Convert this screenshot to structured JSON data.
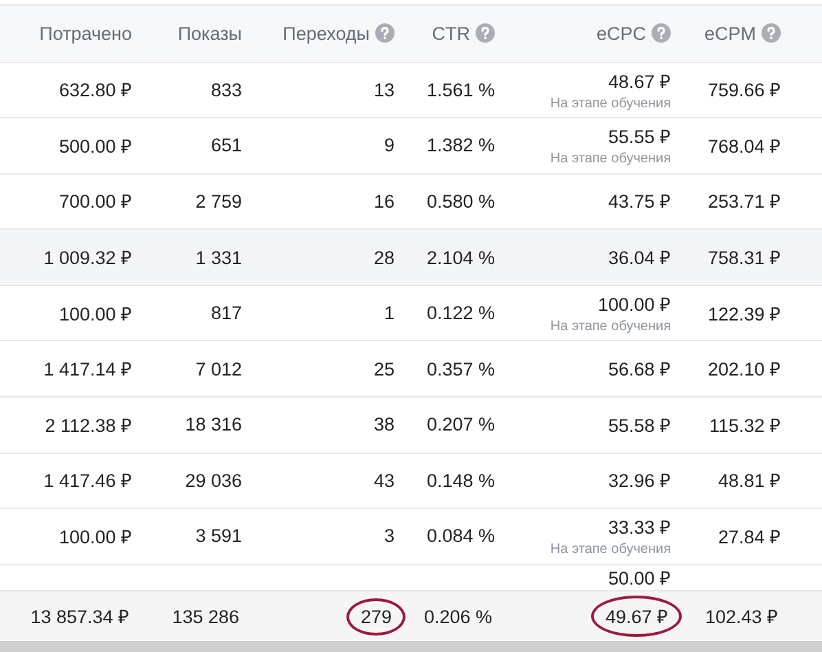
{
  "columns": [
    {
      "label": "Потрачено",
      "help": false
    },
    {
      "label": "Показы",
      "help": false
    },
    {
      "label": "Переходы",
      "help": true
    },
    {
      "label": "CTR",
      "help": true
    },
    {
      "label": "eCPC",
      "help": true
    },
    {
      "label": "eCPM",
      "help": true
    }
  ],
  "rows": [
    {
      "highlighted": false,
      "spent": "632.80 ₽",
      "impressions": "833",
      "clicks": "13",
      "ctr": "1.561 %",
      "ecpc": "48.67 ₽",
      "ecpc_note": "На этапе обучения",
      "ecpm": "759.66 ₽"
    },
    {
      "highlighted": false,
      "spent": "500.00 ₽",
      "impressions": "651",
      "clicks": "9",
      "ctr": "1.382 %",
      "ecpc": "55.55 ₽",
      "ecpc_note": "На этапе обучения",
      "ecpm": "768.04 ₽"
    },
    {
      "highlighted": false,
      "spent": "700.00 ₽",
      "impressions": "2 759",
      "clicks": "16",
      "ctr": "0.580 %",
      "ecpc": "43.75 ₽",
      "ecpm": "253.71 ₽"
    },
    {
      "highlighted": true,
      "spent": "1 009.32 ₽",
      "impressions": "1 331",
      "clicks": "28",
      "ctr": "2.104 %",
      "ecpc": "36.04 ₽",
      "ecpm": "758.31 ₽"
    },
    {
      "highlighted": false,
      "spent": "100.00 ₽",
      "impressions": "817",
      "clicks": "1",
      "ctr": "0.122 %",
      "ecpc": "100.00 ₽",
      "ecpc_note": "На этапе обучения",
      "ecpm": "122.39 ₽"
    },
    {
      "highlighted": false,
      "spent": "1 417.14 ₽",
      "impressions": "7 012",
      "clicks": "25",
      "ctr": "0.357 %",
      "ecpc": "56.68 ₽",
      "ecpm": "202.10 ₽"
    },
    {
      "highlighted": false,
      "spent": "2 112.38 ₽",
      "impressions": "18 316",
      "clicks": "38",
      "ctr": "0.207 %",
      "ecpc": "55.58 ₽",
      "ecpm": "115.32 ₽"
    },
    {
      "highlighted": false,
      "spent": "1 417.46 ₽",
      "impressions": "29 036",
      "clicks": "43",
      "ctr": "0.148 %",
      "ecpc": "32.96 ₽",
      "ecpm": "48.81 ₽"
    },
    {
      "highlighted": false,
      "spent": "100.00 ₽",
      "impressions": "3 591",
      "clicks": "3",
      "ctr": "0.084 %",
      "ecpc": "33.33 ₽",
      "ecpc_note": "На этапе обучения",
      "ecpm": "27.84 ₽"
    }
  ],
  "partial_row": {
    "ecpc": "50.00 ₽"
  },
  "totals": [
    {
      "value": "13 857.34 ₽",
      "circled": false
    },
    {
      "value": "135 286",
      "circled": false
    },
    {
      "value": "279",
      "circled": true
    },
    {
      "value": "0.206 %",
      "circled": false
    },
    {
      "value": "49.67 ₽",
      "circled": true
    },
    {
      "value": "102.43 ₽",
      "circled": false
    }
  ]
}
